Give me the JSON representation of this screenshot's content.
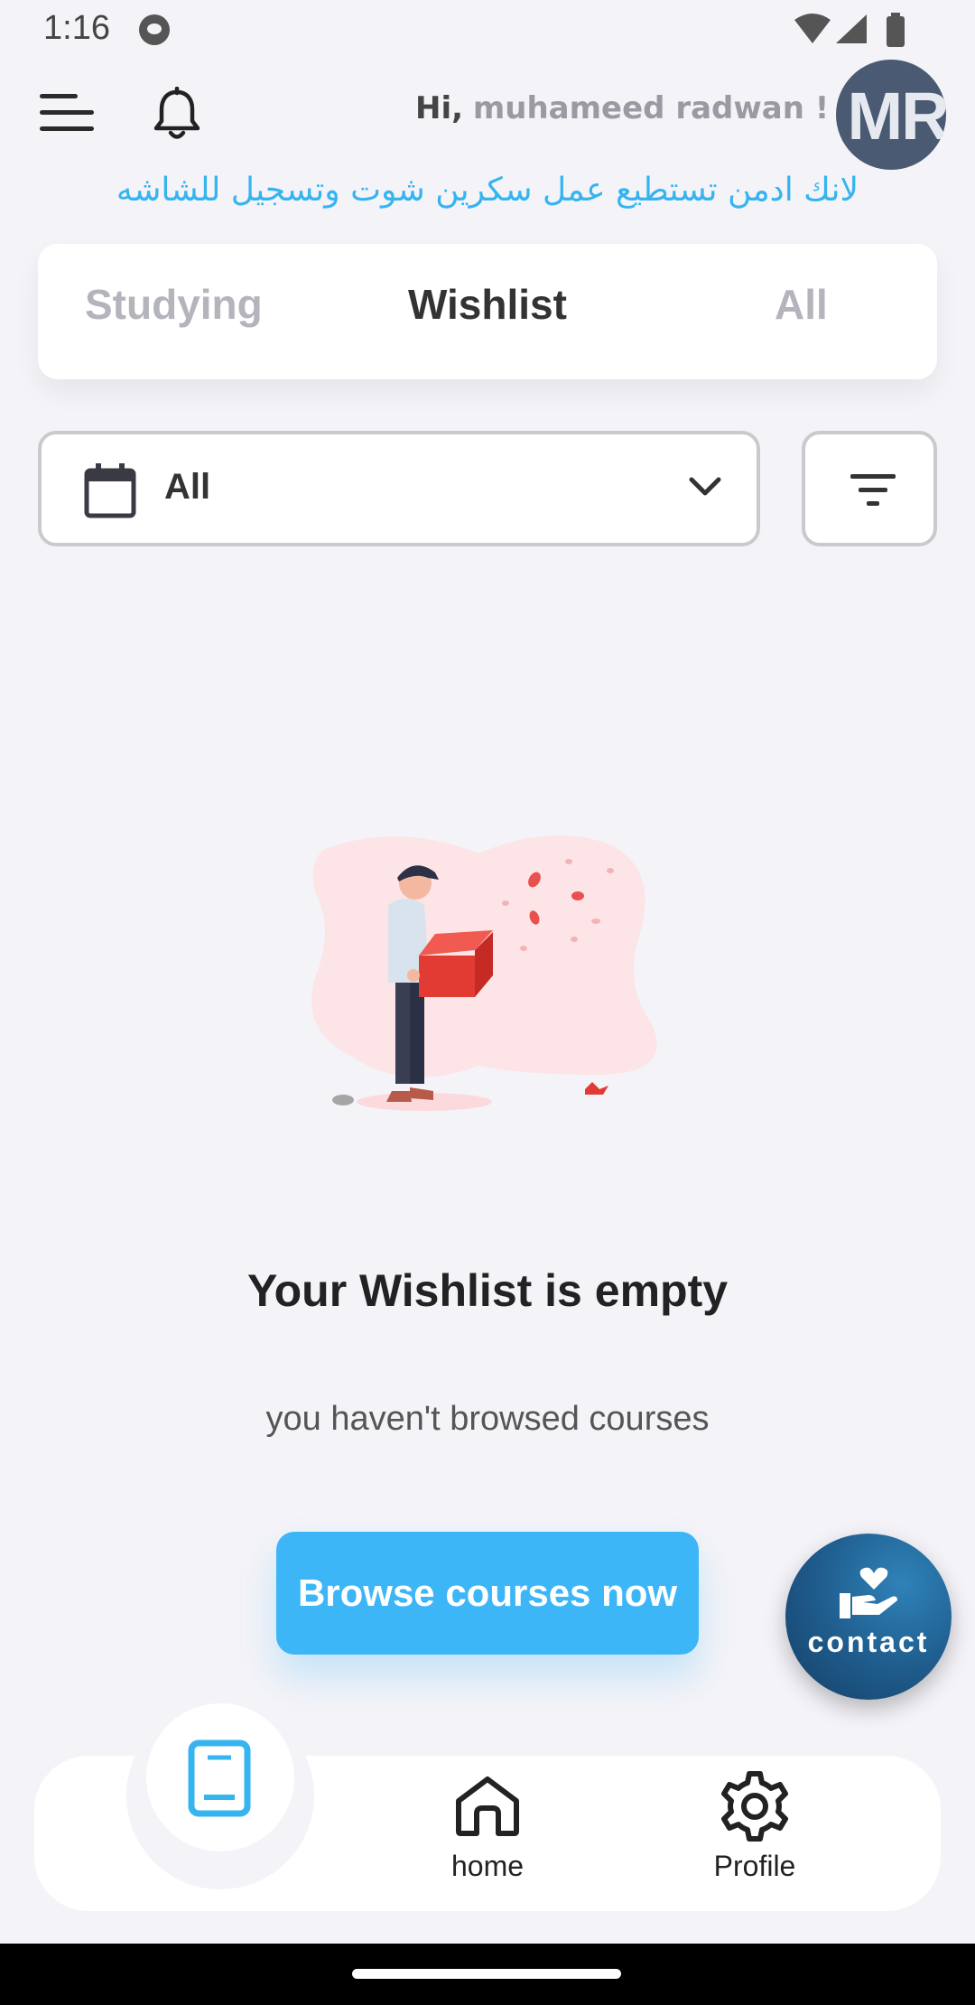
{
  "status_bar": {
    "time": "1:16"
  },
  "header": {
    "greeting_prefix": "Hi,",
    "user_name": "muhameed radwan !",
    "avatar_initials": "MR",
    "notice": "لانك ادمن تستطيع عمل سكرين شوت وتسجيل للشاشه"
  },
  "tabs": [
    {
      "label": "Studying",
      "active": false
    },
    {
      "label": "Wishlist",
      "active": true
    },
    {
      "label": "All",
      "active": false
    }
  ],
  "filter": {
    "date_value": "All"
  },
  "empty_state": {
    "title": "Your Wishlist is empty",
    "subtitle": "you haven't browsed courses",
    "button_label": "Browse courses now"
  },
  "fab": {
    "label": "contact"
  },
  "bottom_nav": {
    "items": [
      {
        "label": "",
        "icon": "book-icon",
        "active": true
      },
      {
        "label": "home",
        "icon": "home-icon",
        "active": false
      },
      {
        "label": "Profile",
        "icon": "gear-icon",
        "active": false
      }
    ]
  },
  "colors": {
    "accent": "#3db6f8",
    "notice_text": "#35b4f0",
    "fab": "#1e5a8a",
    "background": "#f4f3f8"
  }
}
